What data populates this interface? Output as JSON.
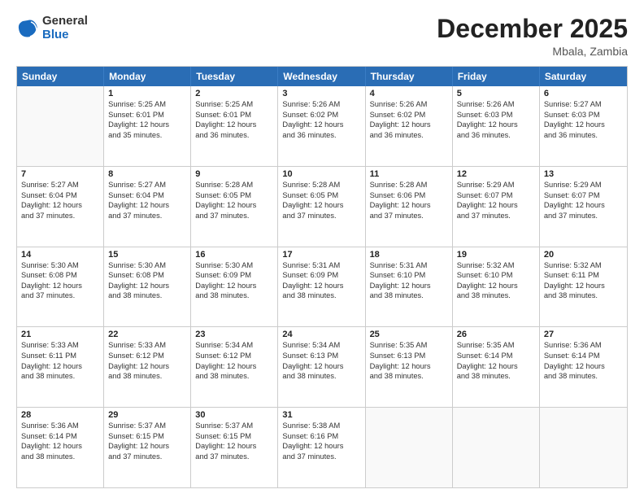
{
  "logo": {
    "general": "General",
    "blue": "Blue"
  },
  "header": {
    "month": "December 2025",
    "location": "Mbala, Zambia"
  },
  "weekdays": [
    "Sunday",
    "Monday",
    "Tuesday",
    "Wednesday",
    "Thursday",
    "Friday",
    "Saturday"
  ],
  "rows": [
    [
      {
        "day": "",
        "lines": []
      },
      {
        "day": "1",
        "lines": [
          "Sunrise: 5:25 AM",
          "Sunset: 6:01 PM",
          "Daylight: 12 hours",
          "and 35 minutes."
        ]
      },
      {
        "day": "2",
        "lines": [
          "Sunrise: 5:25 AM",
          "Sunset: 6:01 PM",
          "Daylight: 12 hours",
          "and 36 minutes."
        ]
      },
      {
        "day": "3",
        "lines": [
          "Sunrise: 5:26 AM",
          "Sunset: 6:02 PM",
          "Daylight: 12 hours",
          "and 36 minutes."
        ]
      },
      {
        "day": "4",
        "lines": [
          "Sunrise: 5:26 AM",
          "Sunset: 6:02 PM",
          "Daylight: 12 hours",
          "and 36 minutes."
        ]
      },
      {
        "day": "5",
        "lines": [
          "Sunrise: 5:26 AM",
          "Sunset: 6:03 PM",
          "Daylight: 12 hours",
          "and 36 minutes."
        ]
      },
      {
        "day": "6",
        "lines": [
          "Sunrise: 5:27 AM",
          "Sunset: 6:03 PM",
          "Daylight: 12 hours",
          "and 36 minutes."
        ]
      }
    ],
    [
      {
        "day": "7",
        "lines": [
          "Sunrise: 5:27 AM",
          "Sunset: 6:04 PM",
          "Daylight: 12 hours",
          "and 37 minutes."
        ]
      },
      {
        "day": "8",
        "lines": [
          "Sunrise: 5:27 AM",
          "Sunset: 6:04 PM",
          "Daylight: 12 hours",
          "and 37 minutes."
        ]
      },
      {
        "day": "9",
        "lines": [
          "Sunrise: 5:28 AM",
          "Sunset: 6:05 PM",
          "Daylight: 12 hours",
          "and 37 minutes."
        ]
      },
      {
        "day": "10",
        "lines": [
          "Sunrise: 5:28 AM",
          "Sunset: 6:05 PM",
          "Daylight: 12 hours",
          "and 37 minutes."
        ]
      },
      {
        "day": "11",
        "lines": [
          "Sunrise: 5:28 AM",
          "Sunset: 6:06 PM",
          "Daylight: 12 hours",
          "and 37 minutes."
        ]
      },
      {
        "day": "12",
        "lines": [
          "Sunrise: 5:29 AM",
          "Sunset: 6:07 PM",
          "Daylight: 12 hours",
          "and 37 minutes."
        ]
      },
      {
        "day": "13",
        "lines": [
          "Sunrise: 5:29 AM",
          "Sunset: 6:07 PM",
          "Daylight: 12 hours",
          "and 37 minutes."
        ]
      }
    ],
    [
      {
        "day": "14",
        "lines": [
          "Sunrise: 5:30 AM",
          "Sunset: 6:08 PM",
          "Daylight: 12 hours",
          "and 37 minutes."
        ]
      },
      {
        "day": "15",
        "lines": [
          "Sunrise: 5:30 AM",
          "Sunset: 6:08 PM",
          "Daylight: 12 hours",
          "and 38 minutes."
        ]
      },
      {
        "day": "16",
        "lines": [
          "Sunrise: 5:30 AM",
          "Sunset: 6:09 PM",
          "Daylight: 12 hours",
          "and 38 minutes."
        ]
      },
      {
        "day": "17",
        "lines": [
          "Sunrise: 5:31 AM",
          "Sunset: 6:09 PM",
          "Daylight: 12 hours",
          "and 38 minutes."
        ]
      },
      {
        "day": "18",
        "lines": [
          "Sunrise: 5:31 AM",
          "Sunset: 6:10 PM",
          "Daylight: 12 hours",
          "and 38 minutes."
        ]
      },
      {
        "day": "19",
        "lines": [
          "Sunrise: 5:32 AM",
          "Sunset: 6:10 PM",
          "Daylight: 12 hours",
          "and 38 minutes."
        ]
      },
      {
        "day": "20",
        "lines": [
          "Sunrise: 5:32 AM",
          "Sunset: 6:11 PM",
          "Daylight: 12 hours",
          "and 38 minutes."
        ]
      }
    ],
    [
      {
        "day": "21",
        "lines": [
          "Sunrise: 5:33 AM",
          "Sunset: 6:11 PM",
          "Daylight: 12 hours",
          "and 38 minutes."
        ]
      },
      {
        "day": "22",
        "lines": [
          "Sunrise: 5:33 AM",
          "Sunset: 6:12 PM",
          "Daylight: 12 hours",
          "and 38 minutes."
        ]
      },
      {
        "day": "23",
        "lines": [
          "Sunrise: 5:34 AM",
          "Sunset: 6:12 PM",
          "Daylight: 12 hours",
          "and 38 minutes."
        ]
      },
      {
        "day": "24",
        "lines": [
          "Sunrise: 5:34 AM",
          "Sunset: 6:13 PM",
          "Daylight: 12 hours",
          "and 38 minutes."
        ]
      },
      {
        "day": "25",
        "lines": [
          "Sunrise: 5:35 AM",
          "Sunset: 6:13 PM",
          "Daylight: 12 hours",
          "and 38 minutes."
        ]
      },
      {
        "day": "26",
        "lines": [
          "Sunrise: 5:35 AM",
          "Sunset: 6:14 PM",
          "Daylight: 12 hours",
          "and 38 minutes."
        ]
      },
      {
        "day": "27",
        "lines": [
          "Sunrise: 5:36 AM",
          "Sunset: 6:14 PM",
          "Daylight: 12 hours",
          "and 38 minutes."
        ]
      }
    ],
    [
      {
        "day": "28",
        "lines": [
          "Sunrise: 5:36 AM",
          "Sunset: 6:14 PM",
          "Daylight: 12 hours",
          "and 38 minutes."
        ]
      },
      {
        "day": "29",
        "lines": [
          "Sunrise: 5:37 AM",
          "Sunset: 6:15 PM",
          "Daylight: 12 hours",
          "and 37 minutes."
        ]
      },
      {
        "day": "30",
        "lines": [
          "Sunrise: 5:37 AM",
          "Sunset: 6:15 PM",
          "Daylight: 12 hours",
          "and 37 minutes."
        ]
      },
      {
        "day": "31",
        "lines": [
          "Sunrise: 5:38 AM",
          "Sunset: 6:16 PM",
          "Daylight: 12 hours",
          "and 37 minutes."
        ]
      },
      {
        "day": "",
        "lines": []
      },
      {
        "day": "",
        "lines": []
      },
      {
        "day": "",
        "lines": []
      }
    ]
  ]
}
